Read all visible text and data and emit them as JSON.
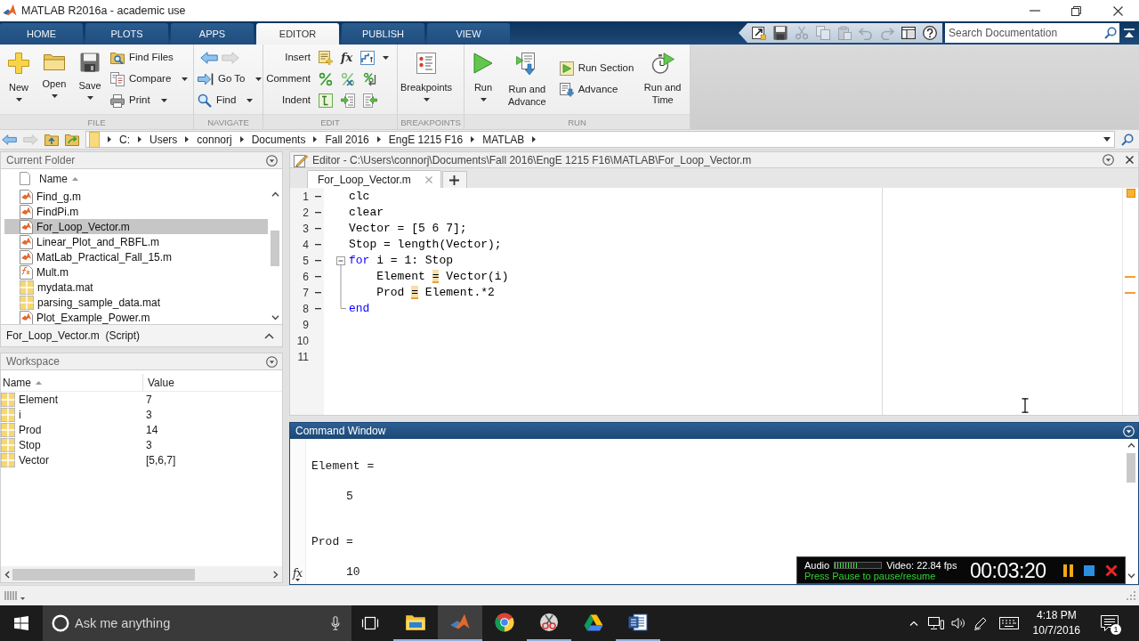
{
  "window": {
    "title": "MATLAB R2016a - academic use"
  },
  "ribbon": {
    "tabs": [
      {
        "label": "HOME",
        "selected": false
      },
      {
        "label": "PLOTS",
        "selected": false
      },
      {
        "label": "APPS",
        "selected": false
      },
      {
        "label": "EDITOR",
        "selected": true
      },
      {
        "label": "PUBLISH",
        "selected": false
      },
      {
        "label": "VIEW",
        "selected": false
      }
    ],
    "groups": [
      {
        "title": "FILE",
        "columns": [
          {
            "kind": "large",
            "label": "New",
            "menu": true
          },
          {
            "kind": "large",
            "label": "Open",
            "menu": true
          },
          {
            "kind": "large",
            "label": "Save",
            "menu": true
          },
          {
            "kind": "stack",
            "rows": [
              {
                "kind": "button",
                "label": "Find Files",
                "menu": false
              },
              {
                "kind": "button",
                "label": "Compare",
                "menu": true
              },
              {
                "kind": "button",
                "label": "Print",
                "menu": true
              }
            ]
          }
        ]
      },
      {
        "title": "NAVIGATE",
        "columns": [
          {
            "kind": "stack",
            "rows": [
              {
                "kind": "arrows",
                "arrows": [
                  {
                    "disabled": false
                  },
                  {
                    "disabled": true
                  }
                ]
              },
              {
                "kind": "button",
                "label": "Go To",
                "menu": true
              },
              {
                "kind": "button",
                "label": "Find",
                "menu": true
              }
            ]
          }
        ]
      },
      {
        "title": "EDIT",
        "columns": [
          {
            "kind": "stack",
            "rows": [
              {
                "kind": "tools",
                "label": "Insert",
                "glyph": "fx",
                "menu": true
              },
              {
                "kind": "tools",
                "label": "Comment",
                "menu": false
              },
              {
                "kind": "tools",
                "label": "Indent",
                "menu": false
              }
            ]
          }
        ]
      },
      {
        "title": "BREAKPOINTS",
        "columns": [
          {
            "kind": "large",
            "label": "Breakpoints",
            "menu": true
          }
        ]
      },
      {
        "title": "RUN",
        "columns": [
          {
            "kind": "large",
            "label": "Run",
            "menu": true
          },
          {
            "kind": "large",
            "label": "Run and Advance",
            "menu": false
          },
          {
            "kind": "stack",
            "rows": [
              {
                "kind": "button",
                "label": "Run Section",
                "menu": false
              },
              {
                "kind": "button",
                "label": "Advance",
                "menu": false
              }
            ]
          },
          {
            "kind": "large",
            "label": "Run and Time",
            "menu": false
          }
        ]
      }
    ]
  },
  "quick_access": {
    "tools": [
      {
        "disabled": false
      },
      {
        "disabled": false
      },
      {
        "disabled": true
      },
      {
        "disabled": true
      },
      {
        "disabled": true
      },
      {
        "disabled": true
      },
      {
        "disabled": true
      },
      {
        "disabled": false
      },
      {
        "disabled": false
      }
    ],
    "search": {
      "placeholder": "Search Documentation"
    }
  },
  "address_bar": {
    "nav": [
      {
        "disabled": false
      },
      {
        "disabled": true
      },
      {
        "disabled": false
      },
      {
        "disabled": false
      }
    ],
    "segments": [
      "C:",
      "Users",
      "connorj",
      "Documents",
      "Fall 2016",
      "EngE 1215 F16",
      "MATLAB"
    ]
  },
  "current_folder": {
    "title": "Current Folder",
    "column": {
      "label": "Name",
      "sorted": true
    },
    "files": [
      {
        "name": "Find_g.m",
        "kind": "script",
        "selected": false
      },
      {
        "name": "FindPi.m",
        "kind": "script",
        "selected": false
      },
      {
        "name": "For_Loop_Vector.m",
        "kind": "script",
        "selected": true
      },
      {
        "name": "Linear_Plot_and_RBFL.m",
        "kind": "script",
        "selected": false
      },
      {
        "name": "MatLab_Practical_Fall_15.m",
        "kind": "script",
        "selected": false
      },
      {
        "name": "Mult.m",
        "kind": "function",
        "selected": false
      },
      {
        "name": "mydata.mat",
        "kind": "data",
        "selected": false
      },
      {
        "name": "parsing_sample_data.mat",
        "kind": "data",
        "selected": false
      },
      {
        "name": "Plot_Example_Power.m",
        "kind": "script",
        "selected": false
      }
    ],
    "details": "For_Loop_Vector.m  (Script)"
  },
  "workspace": {
    "title": "Workspace",
    "columns": [
      {
        "label": "Name",
        "sorted": true
      },
      {
        "label": "Value",
        "sorted": false
      }
    ],
    "rows": [
      {
        "name": "Element",
        "value": "7"
      },
      {
        "name": "i",
        "value": "3"
      },
      {
        "name": "Prod",
        "value": "14"
      },
      {
        "name": "Stop",
        "value": "3"
      },
      {
        "name": "Vector",
        "value": "[5,6,7]"
      }
    ]
  },
  "editor": {
    "title": "Editor - C:\\Users\\connorj\\Documents\\Fall 2016\\EngE 1215 F16\\MATLAB\\For_Loop_Vector.m",
    "tabs": [
      {
        "label": "For_Loop_Vector.m",
        "selected": true
      }
    ],
    "lines": [
      {
        "number": "1",
        "executable": true,
        "code": [
          {
            "kind": "plain",
            "text": "clc"
          }
        ]
      },
      {
        "number": "2",
        "executable": true,
        "code": [
          {
            "kind": "plain",
            "text": "clear"
          }
        ]
      },
      {
        "number": "3",
        "executable": true,
        "code": [
          {
            "kind": "plain",
            "text": "Vector = [5 6 7];"
          }
        ]
      },
      {
        "number": "4",
        "executable": true,
        "code": [
          {
            "kind": "plain",
            "text": "Stop = length(Vector);"
          }
        ]
      },
      {
        "number": "5",
        "executable": true,
        "code": [
          {
            "kind": "keyword",
            "text": "for"
          },
          {
            "kind": "plain",
            "text": " i = 1: Stop"
          }
        ],
        "children": [
          {
            "number": "6",
            "executable": true,
            "code": [
              {
                "kind": "plain",
                "text": "Element "
              },
              {
                "kind": "warning",
                "text": "="
              },
              {
                "kind": "plain",
                "text": " Vector(i)"
              }
            ]
          },
          {
            "number": "7",
            "executable": true,
            "code": [
              {
                "kind": "plain",
                "text": "Prod "
              },
              {
                "kind": "warning",
                "text": "="
              },
              {
                "kind": "plain",
                "text": " Element.*2"
              }
            ]
          }
        ]
      },
      {
        "number": "8",
        "executable": true,
        "code": [
          {
            "kind": "keyword",
            "text": "end"
          }
        ]
      },
      {
        "number": "9",
        "executable": false
      },
      {
        "number": "10",
        "executable": false
      },
      {
        "number": "11",
        "executable": false
      }
    ]
  },
  "command_window": {
    "title": "Command Window",
    "prompt": "fx",
    "output": [
      {
        "kind": "name",
        "text": "Element ="
      },
      {
        "kind": "value",
        "text": "5"
      },
      {
        "kind": "name",
        "text": "Prod ="
      },
      {
        "kind": "value",
        "text": "10"
      }
    ]
  },
  "recorder": {
    "audio_label": "Audio",
    "audio_meter": {
      "level": 0.5
    },
    "video_status": "Video: 22.84 fps",
    "hint": "Press Pause to pause/resume",
    "elapsed": "00:03:20"
  },
  "taskbar": {
    "search": {
      "placeholder": "Ask me anything"
    },
    "apps": [
      {
        "running": true,
        "selected": false
      },
      {
        "running": true,
        "selected": true
      },
      {
        "running": false,
        "selected": false
      },
      {
        "running": true,
        "selected": false
      },
      {
        "running": false,
        "selected": false
      },
      {
        "running": true,
        "selected": false
      }
    ],
    "clock": {
      "time": "4:18 PM",
      "date": "10/7/2016"
    },
    "notifications": "1"
  }
}
